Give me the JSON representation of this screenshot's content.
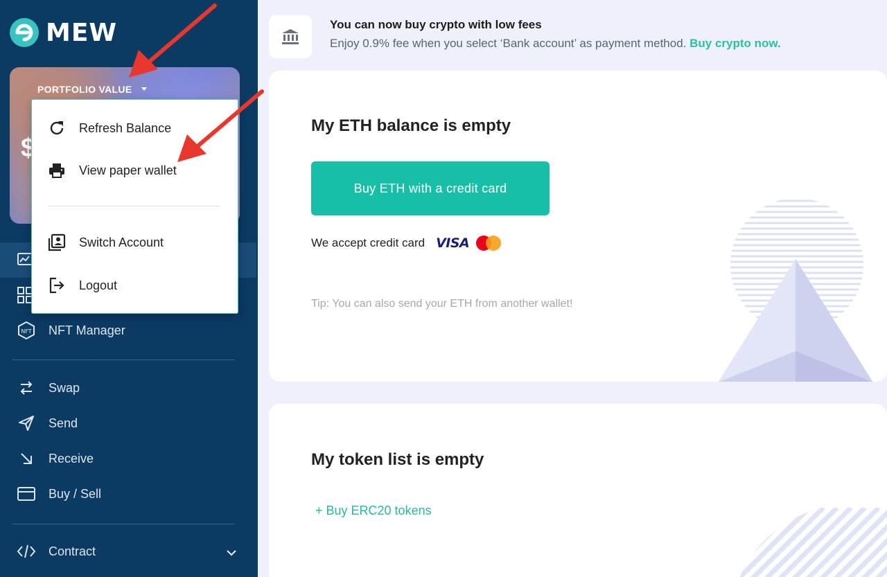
{
  "brand": {
    "name": "MEW"
  },
  "portfolio": {
    "label": "PORTFOLIO VALUE",
    "balance_prefix": "$"
  },
  "dropdown": {
    "items": [
      {
        "label": "Refresh Balance",
        "icon": "refresh-icon"
      },
      {
        "label": "View paper wallet",
        "icon": "printer-icon"
      },
      {
        "label": "Switch Account",
        "icon": "switch-account-icon"
      },
      {
        "label": "Logout",
        "icon": "logout-icon"
      }
    ]
  },
  "sidebar": {
    "items": [
      {
        "label": "NFT Manager",
        "icon": "nft-icon"
      },
      {
        "label": "Swap",
        "icon": "swap-icon"
      },
      {
        "label": "Send",
        "icon": "send-icon"
      },
      {
        "label": "Receive",
        "icon": "receive-icon"
      },
      {
        "label": "Buy / Sell",
        "icon": "credit-card-icon"
      },
      {
        "label": "Contract",
        "icon": "code-icon"
      }
    ]
  },
  "banner": {
    "title": "You can now buy crypto with low fees",
    "desc": "Enjoy 0.9% fee when you select ‘Bank account’ as payment method.",
    "link": "Buy crypto now."
  },
  "eth_card": {
    "title": "My ETH balance is empty",
    "button": "Buy ETH with a credit card",
    "accept": "We accept credit card",
    "visa": "VISA",
    "tip": "Tip: You can also send your ETH from another wallet!"
  },
  "token_card": {
    "title": "My token list is empty",
    "link": "+ Buy ERC20 tokens"
  },
  "colors": {
    "sidebar": "#0b3a63",
    "accent": "#17bfa7",
    "background": "#eef1f9"
  }
}
